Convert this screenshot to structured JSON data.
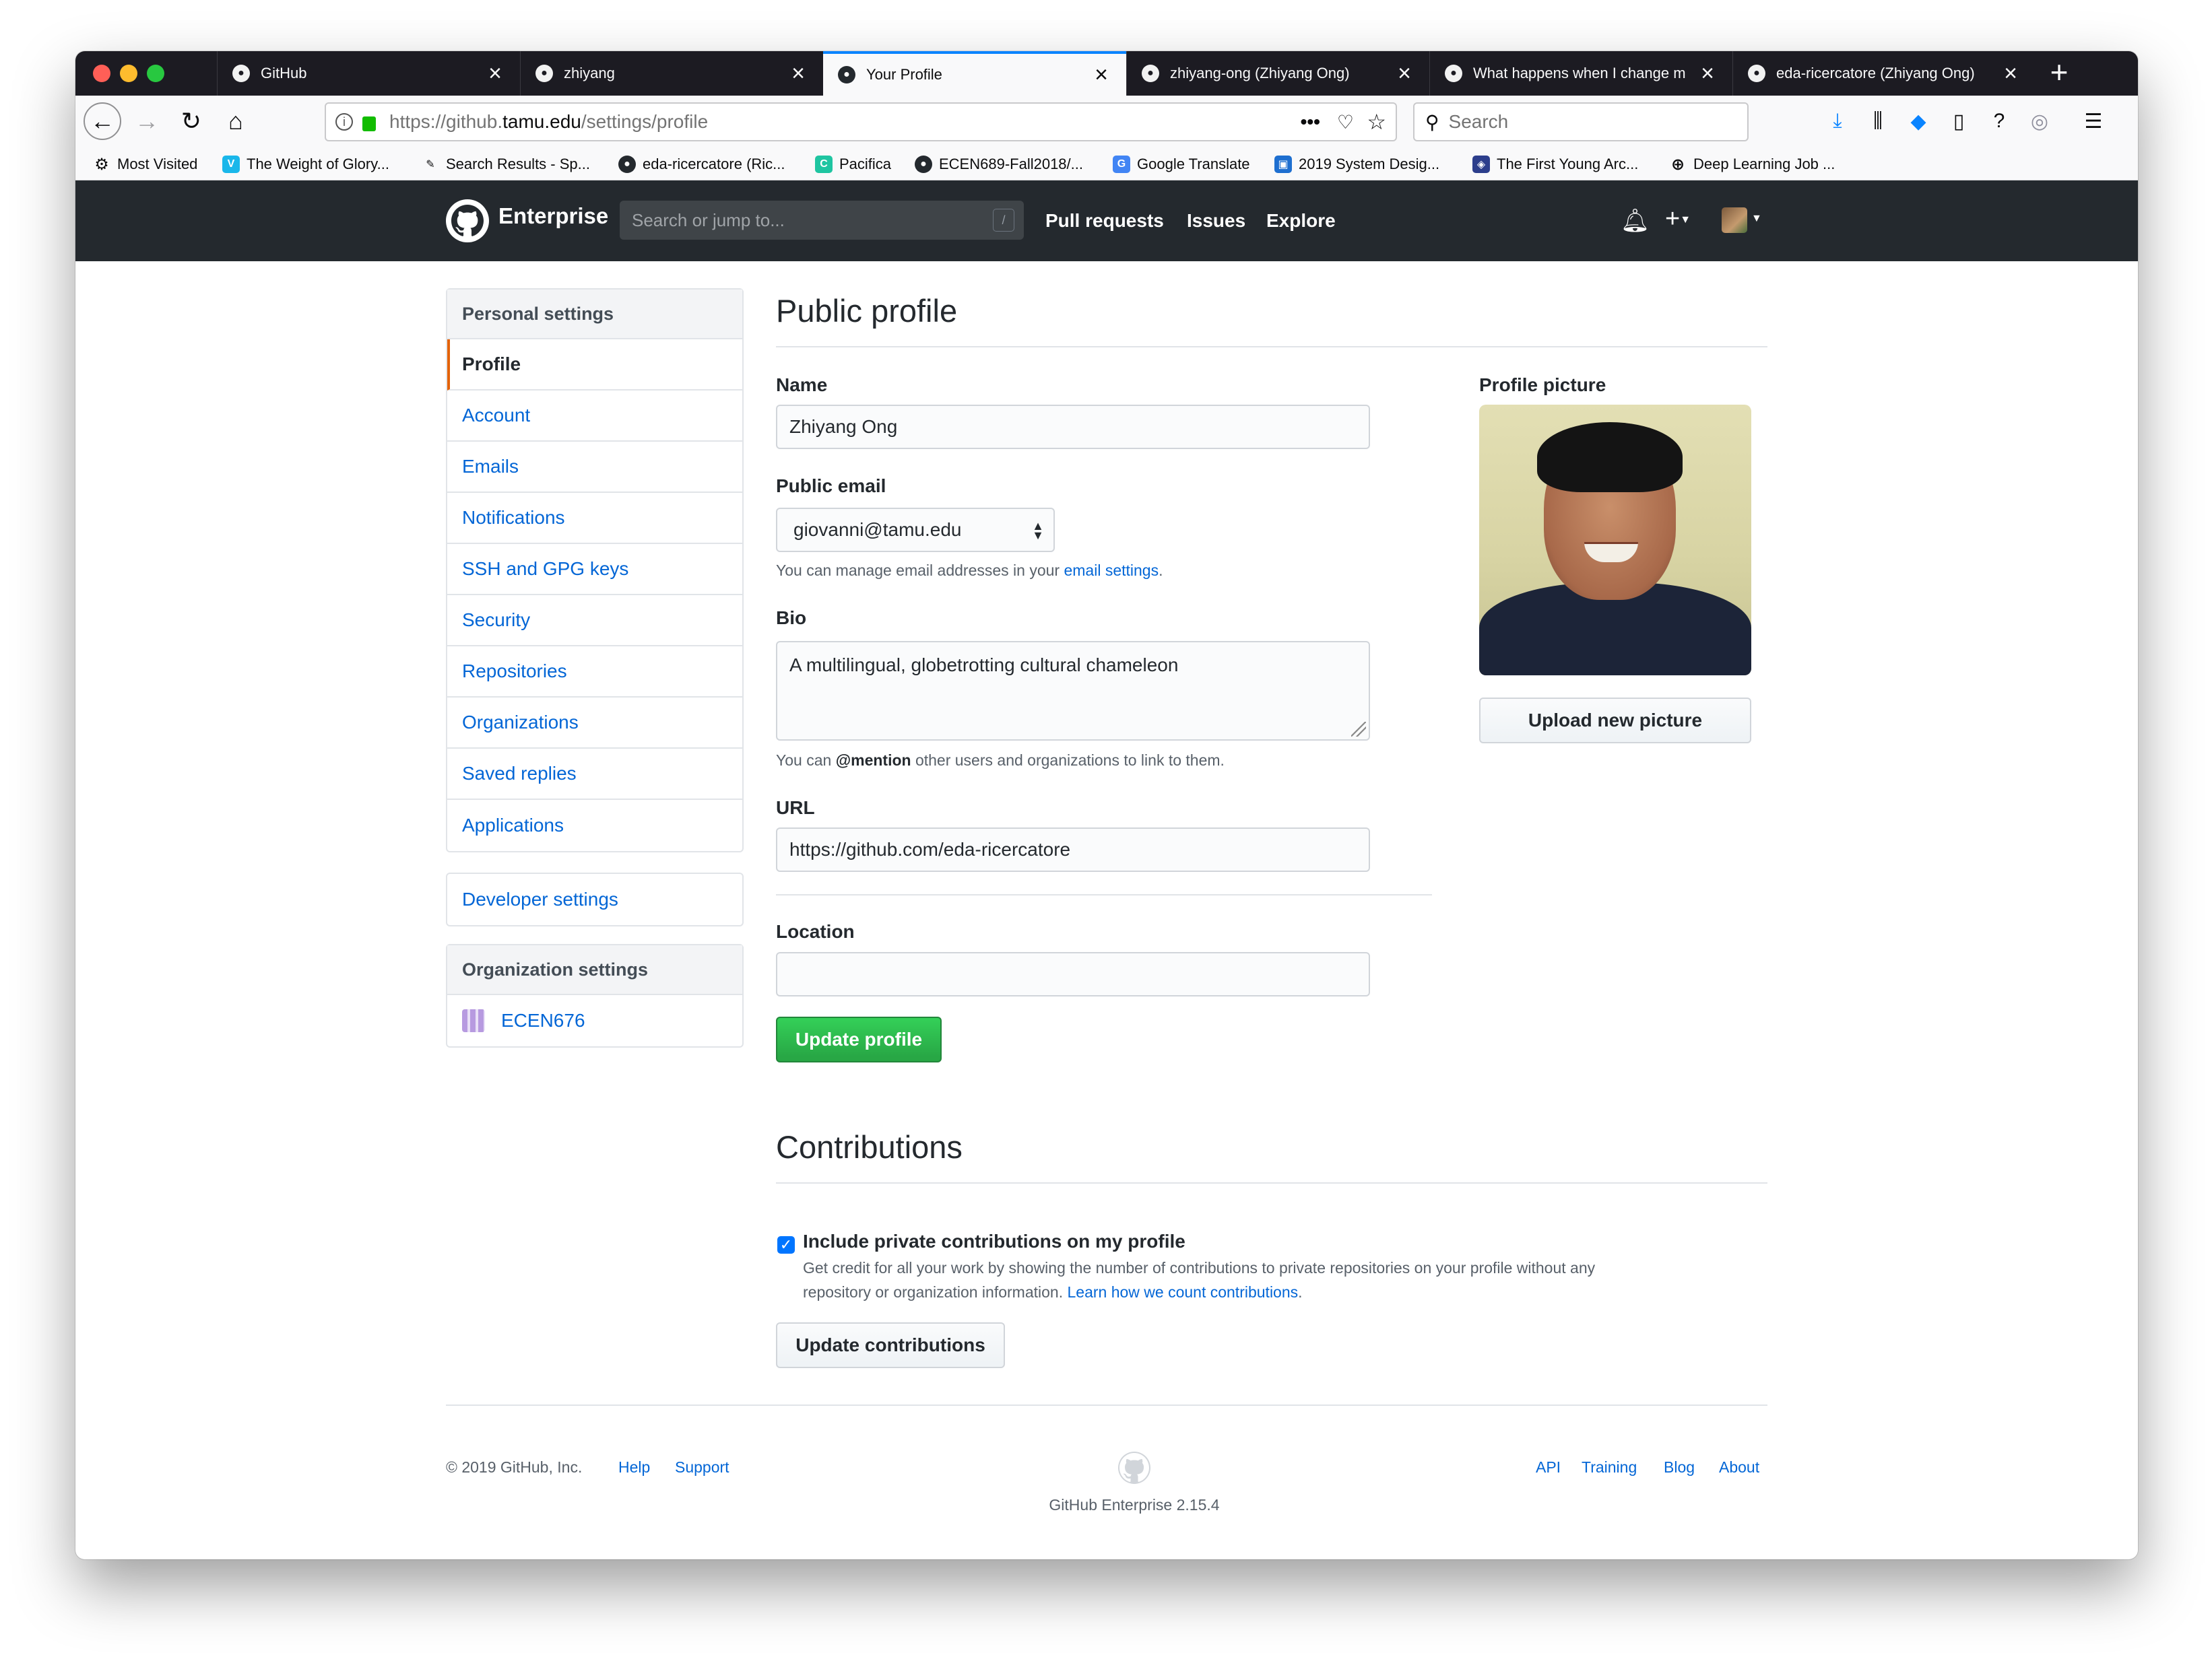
{
  "browser": {
    "tabs": [
      {
        "title": "GitHub",
        "active": false
      },
      {
        "title": "zhiyang",
        "active": false
      },
      {
        "title": "Your Profile",
        "active": true
      },
      {
        "title": "zhiyang-ong (Zhiyang Ong)",
        "active": false
      },
      {
        "title": "What happens when I change m",
        "active": false
      },
      {
        "title": "eda-ricercatore (Zhiyang Ong)",
        "active": false
      }
    ],
    "url": {
      "prefix": "https://github.",
      "domain": "tamu.edu",
      "path": "/settings/profile"
    },
    "search_placeholder": "Search",
    "bookmarks": [
      {
        "label": "Most Visited",
        "icon": "gear-icon"
      },
      {
        "label": "The Weight of Glory...",
        "icon": "vimeo-icon"
      },
      {
        "label": "Search Results - Sp...",
        "icon": "search-results-icon"
      },
      {
        "label": "eda-ricercatore (Ric...",
        "icon": "github-icon"
      },
      {
        "label": "Pacifica",
        "icon": "pacifica-icon"
      },
      {
        "label": "ECEN689-Fall2018/...",
        "icon": "github-icon"
      },
      {
        "label": "Google Translate",
        "icon": "translate-icon"
      },
      {
        "label": "2019 System Desig...",
        "icon": "conference-icon"
      },
      {
        "label": "The First Young Arc...",
        "icon": "shield-icon"
      },
      {
        "label": "Deep Learning Job ...",
        "icon": "globe-icon"
      }
    ]
  },
  "header": {
    "brand": "Enterprise",
    "search_placeholder": "Search or jump to...",
    "search_key": "/",
    "nav": [
      "Pull requests",
      "Issues",
      "Explore"
    ]
  },
  "sidebar": {
    "personal_header": "Personal settings",
    "items": [
      "Profile",
      "Account",
      "Emails",
      "Notifications",
      "SSH and GPG keys",
      "Security",
      "Repositories",
      "Organizations",
      "Saved replies",
      "Applications"
    ],
    "developer": "Developer settings",
    "org_header": "Organization settings",
    "org_item": "ECEN676"
  },
  "profile": {
    "title": "Public profile",
    "name_label": "Name",
    "name_value": "Zhiyang Ong",
    "email_label": "Public email",
    "email_value": "giovanni@tamu.edu",
    "email_note_pre": "You can manage email addresses in your ",
    "email_note_link": "email settings",
    "email_note_post": ".",
    "bio_label": "Bio",
    "bio_value": "A multilingual, globetrotting cultural chameleon",
    "bio_note_pre": "You can ",
    "bio_note_mention": "@mention",
    "bio_note_post": " other users and organizations to link to them.",
    "url_label": "URL",
    "url_value": "https://github.com/eda-ricercatore",
    "location_label": "Location",
    "location_value": "",
    "update_button": "Update profile",
    "picture_label": "Profile picture",
    "upload_button": "Upload new picture"
  },
  "contributions": {
    "title": "Contributions",
    "checkbox_label": "Include private contributions on my profile",
    "checked": true,
    "note_line1": "Get credit for all your work by showing the number of contributions to private repositories on your profile without any",
    "note_line2": "repository or organization information. ",
    "note_link": "Learn how we count contributions",
    "note_post": ".",
    "button": "Update contributions"
  },
  "footer": {
    "copyright": "© 2019 GitHub, Inc.",
    "left_links": [
      "Help",
      "Support"
    ],
    "right_links": [
      "API",
      "Training",
      "Blog",
      "About"
    ],
    "version": "GitHub Enterprise 2.15.4"
  }
}
